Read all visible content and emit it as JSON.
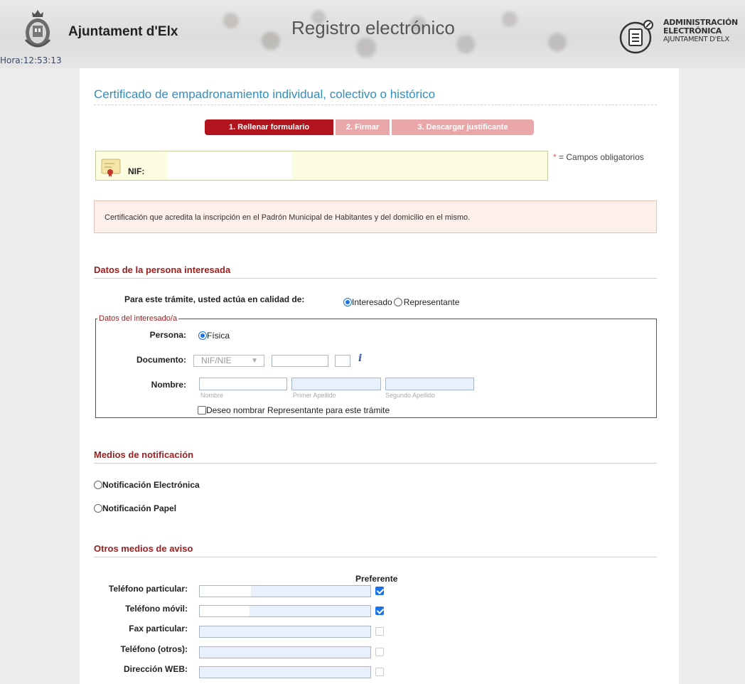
{
  "header": {
    "brand": "Ajuntament d'Elx",
    "clock": "Hora:12:53:13",
    "site_title": "Registro electrónico",
    "admin_lines": [
      "ADMINISTRACIÓN",
      "ELECTRÓNICA",
      "AJUNTAMENT D'ELX"
    ]
  },
  "page": {
    "title": "Certificado de empadronamiento individual, colectivo o histórico",
    "steps": [
      "1. Rellenar formulario",
      "2. Firmar",
      "3. Descargar justificante"
    ],
    "nif_label": "NIF:",
    "required_star": "*",
    "required_note": "= Campos obligatorios",
    "info_text": "Certificación que acredita la inscripción en el Padrón Municipal de Habitantes y del domicilio en el mismo."
  },
  "interesada": {
    "section_title": "Datos de la persona interesada",
    "capacity_label": "Para este trámite, usted actúa en calidad de:",
    "options": [
      "Interesado",
      "Representante"
    ],
    "fieldset_legend": "Datos del interesado/a",
    "persona_label": "Persona:",
    "persona_value": "Física",
    "documento_label": "Documento:",
    "documento_select": "NIF/NIE",
    "nombre_label": "Nombre:",
    "sub_labels": [
      "Nombre",
      "Primer Apellido",
      "Segundo Apellido"
    ],
    "representante_checkbox": "Deseo nombrar Representante para este trámite"
  },
  "notificacion": {
    "section_title": "Medios de notificación",
    "options": [
      "Notificación Electrónica",
      "Notificación Papel"
    ]
  },
  "aviso": {
    "section_title": "Otros medios de aviso",
    "preferente_label": "Preferente",
    "rows": [
      {
        "label": "Teléfono particular:",
        "preferente": true
      },
      {
        "label": "Teléfono móvil:",
        "preferente": true
      },
      {
        "label": "Fax particular:",
        "preferente": false
      },
      {
        "label": "Teléfono (otros):",
        "preferente": false
      },
      {
        "label": "Dirección WEB:",
        "preferente": false
      }
    ]
  },
  "colors": {
    "accent_blue": "#2f8fbe",
    "section_red": "#9c2020",
    "step_active": "#b2141e",
    "step_inactive": "#e9a7aa"
  }
}
